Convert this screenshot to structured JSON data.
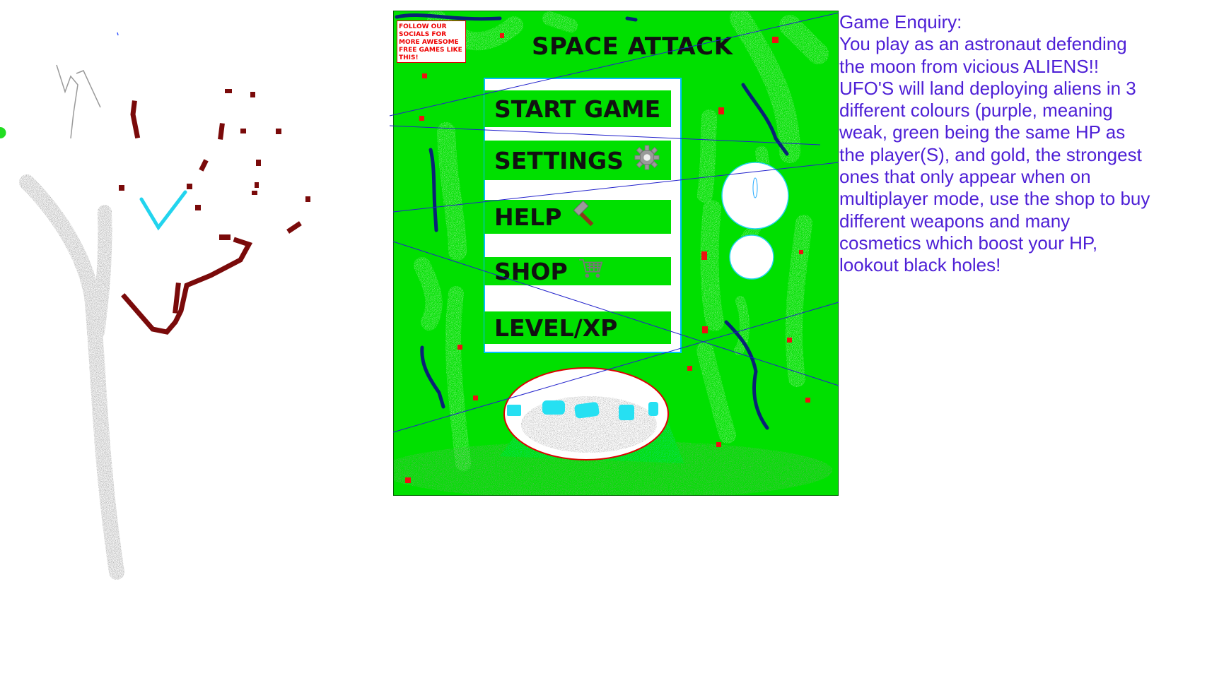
{
  "socials_note": "FOLLOW OUR SOCIALS FOR MORE AWESOME FREE GAMES LIKE THIS!",
  "game": {
    "title": "SPACE ATTACK",
    "menu": [
      {
        "id": "start",
        "label": "START GAME",
        "icon": ""
      },
      {
        "id": "settings",
        "label": "SETTINGS",
        "icon": "gear-icon"
      },
      {
        "id": "help",
        "label": "HELP",
        "icon": "hammer-icon"
      },
      {
        "id": "shop",
        "label": "SHOP",
        "icon": "cart-icon"
      },
      {
        "id": "level",
        "label": "LEVEL/XP",
        "icon": ""
      }
    ]
  },
  "enquiry": {
    "title": "Game Enquiry:",
    "body": "You play as an astronaut defending the moon from vicious ALIENS!! UFO'S will land deploying aliens in 3 different colours (purple, meaning weak, green being the same HP as the player(S), and gold, the strongest ones that only appear when on multiplayer mode, use the shop to buy different weapons and many cosmetics which boost your HP, lookout black holes!"
  },
  "colors": {
    "background_green": "#00e000",
    "enquiry_text": "#4d1fd6",
    "socials_text": "#ee0000",
    "panel_border": "#00bfff"
  }
}
